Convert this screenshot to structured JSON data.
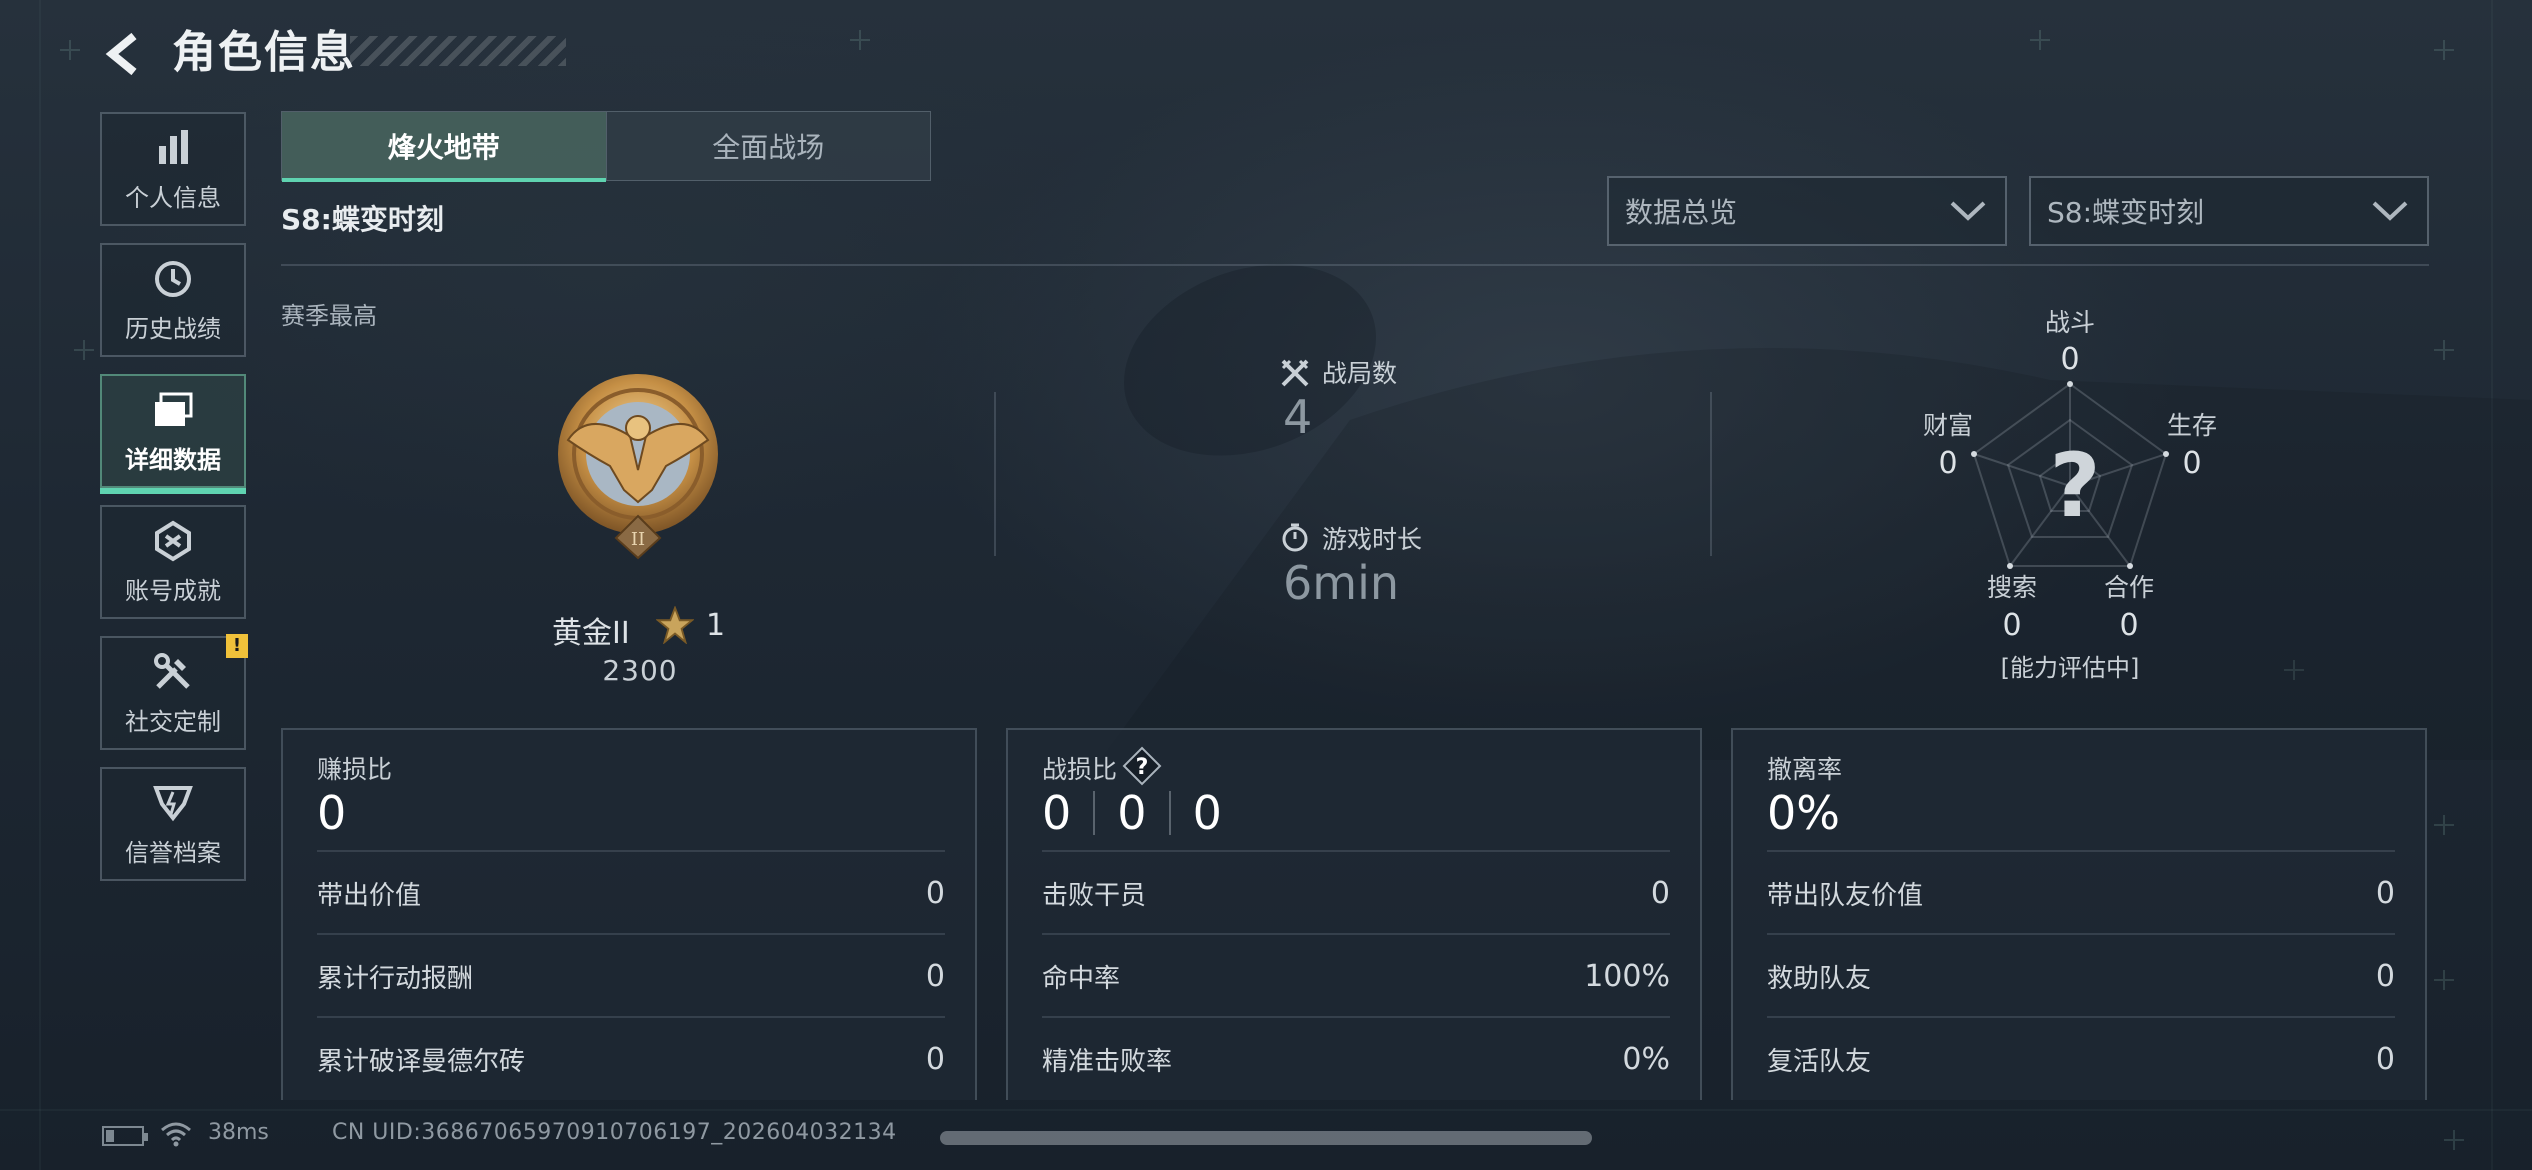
{
  "header": {
    "title": "角色信息"
  },
  "sidebar": {
    "items": [
      {
        "label": "个人信息",
        "icon": "bar-chart-icon"
      },
      {
        "label": "历史战绩",
        "icon": "history-clock-icon"
      },
      {
        "label": "详细数据",
        "icon": "folder-stack-icon",
        "active": true
      },
      {
        "label": "账号成就",
        "icon": "achievement-icon"
      },
      {
        "label": "社交定制",
        "icon": "tools-icon",
        "badge": "!"
      },
      {
        "label": "信誉档案",
        "icon": "credit-shield-icon"
      }
    ]
  },
  "tabs": [
    {
      "label": "烽火地带",
      "active": true
    },
    {
      "label": "全面战场",
      "active": false
    }
  ],
  "season_title": "S8:蝶变时刻",
  "filters": {
    "view": "数据总览",
    "season": "S8:蝶变时刻"
  },
  "best": {
    "label": "赛季最高",
    "rank_name": "黄金II",
    "stars": "1",
    "score": "2300",
    "badge_numeral": "II"
  },
  "overview": {
    "matches_label": "战局数",
    "matches_value": "4",
    "time_label": "游戏时长",
    "time_value": "6min"
  },
  "radar": {
    "combat_label": "战斗",
    "combat_value": "0",
    "survival_label": "生存",
    "survival_value": "0",
    "teamwork_label": "合作",
    "teamwork_value": "0",
    "search_label": "搜索",
    "search_value": "0",
    "wealth_label": "财富",
    "wealth_value": "0",
    "unknown_mark": "?",
    "status": "[能力评估中]"
  },
  "cards": {
    "profit": {
      "title": "赚损比",
      "value": "0",
      "rows": [
        {
          "k": "带出价值",
          "v": "0"
        },
        {
          "k": "累计行动报酬",
          "v": "0"
        },
        {
          "k": "累计破译曼德尔砖",
          "v": "0"
        }
      ]
    },
    "kd": {
      "title": "战损比",
      "help": "?",
      "values": [
        "0",
        "0",
        "0"
      ],
      "rows": [
        {
          "k": "击败干员",
          "v": "0"
        },
        {
          "k": "命中率",
          "v": "100%"
        },
        {
          "k": "精准击败率",
          "v": "0%"
        }
      ]
    },
    "extract": {
      "title": "撤离率",
      "value": "0%",
      "rows": [
        {
          "k": "带出队友价值",
          "v": "0"
        },
        {
          "k": "救助队友",
          "v": "0"
        },
        {
          "k": "复活队友",
          "v": "0"
        }
      ]
    }
  },
  "footer": {
    "ping": "38ms",
    "uid": "CN UID:3686706597091070619​7_202604032134"
  },
  "colors": {
    "accent": "#5fd3b0",
    "badge": "#f0c13a"
  }
}
